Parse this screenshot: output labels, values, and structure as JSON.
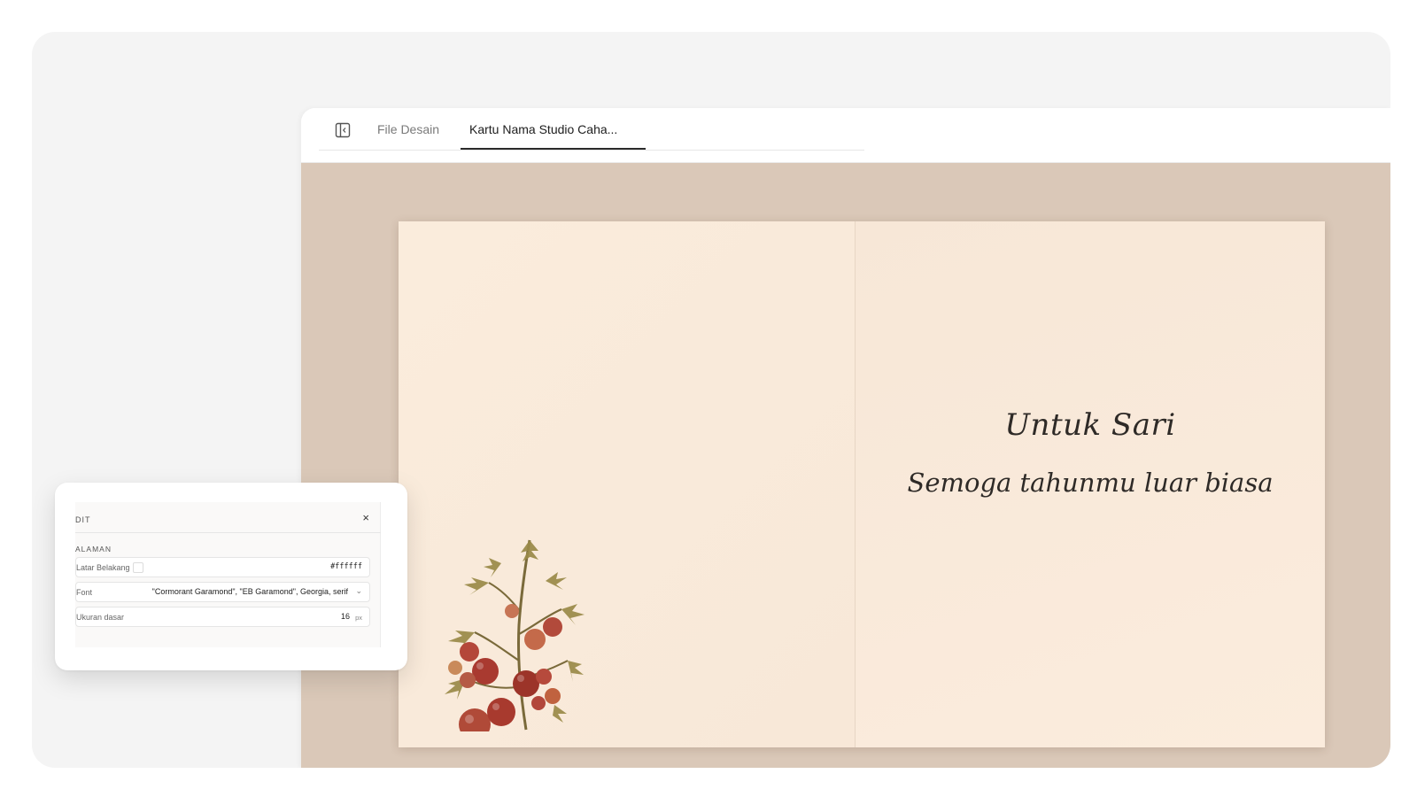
{
  "tabs": {
    "files_label": "File Desain",
    "active_label": "Kartu Nama Studio Caha..."
  },
  "card": {
    "recipient": "Untuk Sari",
    "message": "Semoga tahunmu luar biasa"
  },
  "panel": {
    "title": "DIT",
    "close_icon": "×",
    "section": "ALAMAN",
    "background": {
      "label": "Latar Belakang",
      "value": "#ffffff"
    },
    "font": {
      "label": "Font",
      "value": "\"Cormorant Garamond\", \"EB Garamond\", Georgia, serif"
    },
    "base_size": {
      "label": "Ukuran dasar",
      "value": "16",
      "unit": "px"
    }
  },
  "colors": {
    "canvas_bg": "#dac8b8",
    "card_bg": "#f9eadb",
    "tab_underline": "#2b2b2b"
  },
  "icons": [
    "sidebar-toggle-icon",
    "chevron-down-icon",
    "close-icon",
    "tomato-plant-illustration"
  ]
}
